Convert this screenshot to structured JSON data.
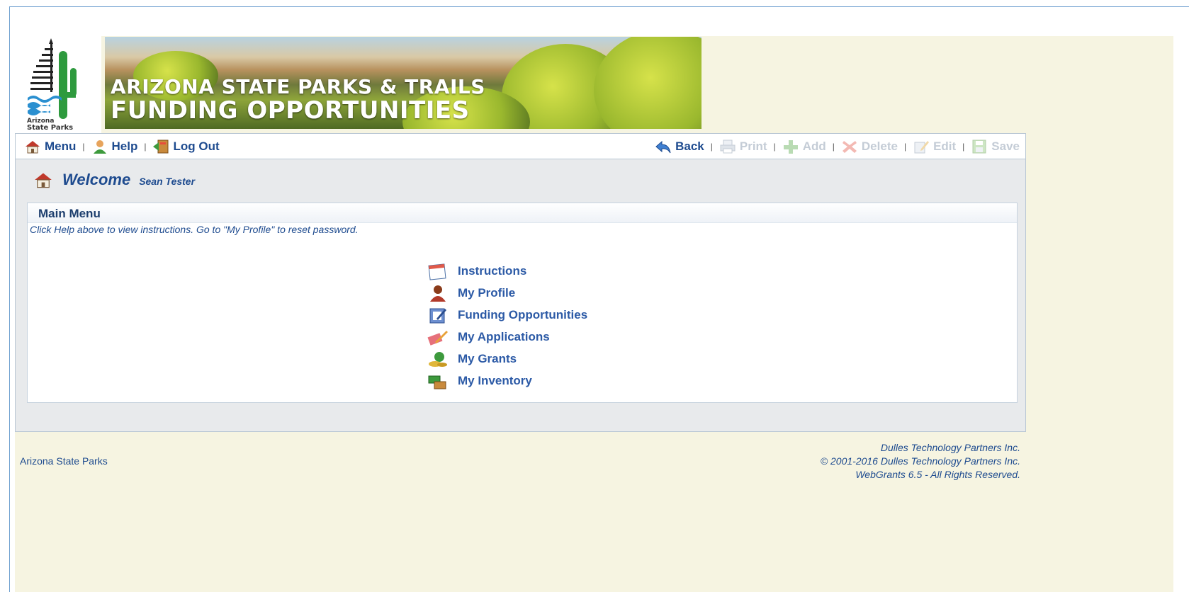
{
  "logo": {
    "text_line1": "Arizona",
    "text_line2": "State Parks"
  },
  "banner": {
    "line1": "ARIZONA STATE PARKS & TRAILS",
    "line2": "FUNDING OPPORTUNITIES"
  },
  "toolbar": {
    "left": [
      {
        "label": "Menu",
        "icon": "home-icon"
      },
      {
        "label": "Help",
        "icon": "user-help-icon"
      },
      {
        "label": "Log Out",
        "icon": "exit-icon"
      }
    ],
    "right": [
      {
        "label": "Back",
        "icon": "back-arrow-icon",
        "enabled": true
      },
      {
        "label": "Print",
        "icon": "printer-icon",
        "enabled": false
      },
      {
        "label": "Add",
        "icon": "add-icon",
        "enabled": false
      },
      {
        "label": "Delete",
        "icon": "delete-icon",
        "enabled": false
      },
      {
        "label": "Edit",
        "icon": "edit-icon",
        "enabled": false
      },
      {
        "label": "Save",
        "icon": "save-icon",
        "enabled": false
      }
    ]
  },
  "welcome": {
    "title": "Welcome",
    "user": "Sean Tester"
  },
  "main_menu": {
    "title": "Main Menu",
    "instructions": "Click Help above to view instructions. Go to \"My Profile\" to reset password.",
    "items": [
      {
        "label": "Instructions",
        "icon": "calendar-icon"
      },
      {
        "label": "My Profile",
        "icon": "person-icon"
      },
      {
        "label": "Funding Opportunities",
        "icon": "clipboard-icon"
      },
      {
        "label": "My Applications",
        "icon": "pencil-icon"
      },
      {
        "label": "My Grants",
        "icon": "money-icon"
      },
      {
        "label": "My Inventory",
        "icon": "boxes-icon"
      }
    ]
  },
  "footer": {
    "left": "Arizona State Parks",
    "right_line1": "Dulles Technology Partners Inc.",
    "right_line2": "© 2001-2016 Dulles Technology Partners Inc.",
    "right_line3": "WebGrants 6.5 - All Rights Reserved."
  },
  "colors": {
    "link": "#1e4b8f",
    "cream_background": "#f6f4e1",
    "disabled": "#c4ccd6"
  }
}
